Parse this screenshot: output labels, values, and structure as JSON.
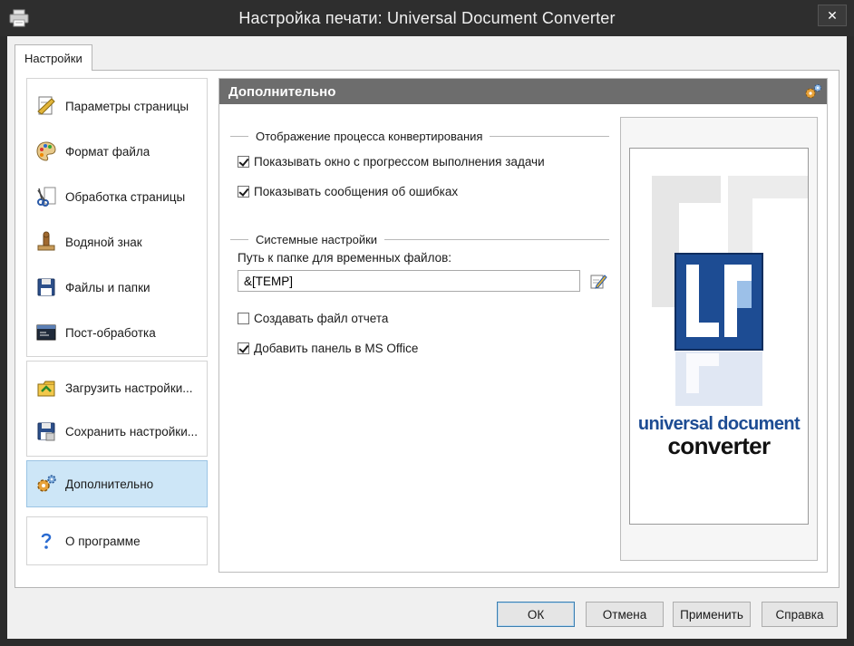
{
  "window": {
    "title": "Настройка печати: Universal Document Converter",
    "close_glyph": "✕",
    "icon": "printer-icon"
  },
  "tabs": [
    {
      "label": "Настройки",
      "selected": true
    }
  ],
  "sidebar": {
    "items": [
      {
        "label": "Параметры страницы",
        "icon": "page-settings-icon"
      },
      {
        "label": "Формат файла",
        "icon": "palette-icon"
      },
      {
        "label": "Обработка страницы",
        "icon": "scissors-icon"
      },
      {
        "label": "Водяной знак",
        "icon": "stamp-icon"
      },
      {
        "label": "Файлы и папки",
        "icon": "floppy-disk-icon"
      },
      {
        "label": "Пост-обработка",
        "icon": "console-icon"
      }
    ],
    "actions": [
      {
        "label": "Загрузить настройки...",
        "icon": "load-settings-icon"
      },
      {
        "label": "Сохранить настройки...",
        "icon": "save-settings-icon"
      }
    ],
    "advanced": {
      "label": "Дополнительно",
      "icon": "gears-icon",
      "selected": true
    },
    "about": {
      "label": "О программе",
      "icon": "question-icon"
    }
  },
  "content": {
    "header": "Дополнительно",
    "header_icon": "gears-icon",
    "section_progress": "Отображение процесса конвертирования",
    "show_progress": {
      "label": "Показывать окно с прогрессом выполнения задачи",
      "checked": true
    },
    "show_errors": {
      "label": "Показывать сообщения об ошибках",
      "checked": true
    },
    "section_system": "Системные настройки",
    "temp_folder_label": "Путь к папке для временных файлов:",
    "temp_folder_value": "&[TEMP]",
    "create_report": {
      "label": "Создавать файл отчета",
      "checked": false
    },
    "ms_office_panel": {
      "label": "Добавить панель в MS Office",
      "checked": true
    },
    "logo": {
      "line1": "universal document",
      "line2": "converter",
      "accent": "#1d4c93"
    }
  },
  "buttons": {
    "ok": "ОК",
    "cancel": "Отмена",
    "apply": "Применить",
    "help": "Справка"
  }
}
